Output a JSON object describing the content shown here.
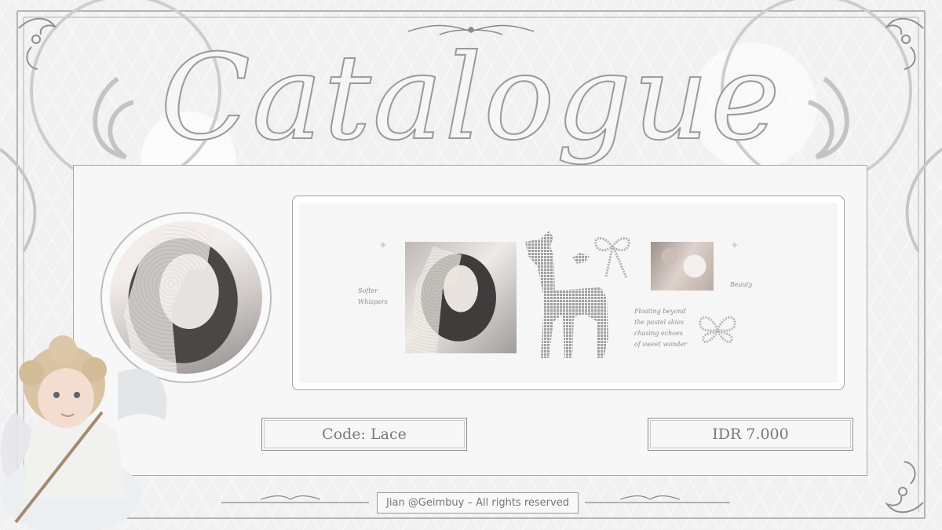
{
  "title": "Catalogue",
  "gallery": {
    "left_caption": "Softer\nWhispers",
    "poem": "Floating beyond\nthe pastel skies\nchasing echoes\nof sweet wonder",
    "right_caption": "Beauty"
  },
  "code_label": "Code: Lace",
  "price_label": "IDR 7.000",
  "footer": "Jian @Geimbuy – All rights reserved",
  "colors": {
    "background": "#f1f1f1",
    "panel": "#f7f7f7",
    "ornament": "#9a9a9a",
    "text": "#7a7a7a"
  },
  "icons": [
    "sparkle-icon",
    "deer-icon",
    "bow-icon",
    "butterfly-icon",
    "cherub-illustration",
    "flourish-ornament"
  ]
}
